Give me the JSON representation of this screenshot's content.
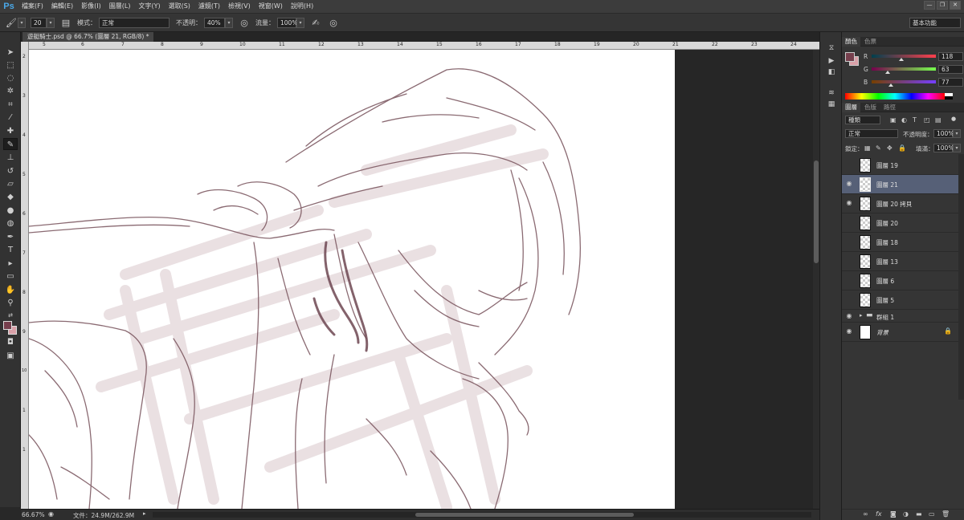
{
  "app": {
    "logo": "Ps",
    "menu": [
      "檔案(F)",
      "編輯(E)",
      "影像(I)",
      "圖層(L)",
      "文字(Y)",
      "選取(S)",
      "濾鏡(T)",
      "檢視(V)",
      "視窗(W)",
      "說明(H)"
    ],
    "window_buttons": [
      "—",
      "❐",
      "✕"
    ]
  },
  "options": {
    "brush_size": "20",
    "mode_label": "模式：",
    "mode_value": "正常",
    "opacity_label": "不透明：",
    "opacity_value": "40%",
    "flow_label": "流量：",
    "flow_value": "100%",
    "workspace": "基本功能"
  },
  "document": {
    "tab_title": "遊艇騎士.psd @ 66.7% (圖層 21, RGB/8) *",
    "ruler_h": [
      "5",
      "6",
      "7",
      "8",
      "9",
      "10",
      "11",
      "12",
      "13",
      "14",
      "15",
      "16",
      "17",
      "18",
      "19",
      "20",
      "21",
      "22",
      "23",
      "24"
    ],
    "ruler_v": [
      "2",
      "3",
      "4",
      "5",
      "6",
      "7",
      "8",
      "9",
      "10",
      "1",
      "1"
    ]
  },
  "status": {
    "zoom": "66.67%",
    "doc_info": "文件：24.9M/262.9M"
  },
  "panels": {
    "color_tabs": [
      "顏色",
      "色票"
    ],
    "color": {
      "fg": "#763f4d",
      "bg": "#d9a0a8",
      "r_label": "R",
      "g_label": "G",
      "b_label": "B",
      "r": "118",
      "g": "63",
      "b": "77",
      "r_fraction": 0.46,
      "g_fraction": 0.25,
      "b_fraction": 0.3
    },
    "layer_tabs": [
      "圖層",
      "色版",
      "路徑"
    ],
    "layers": {
      "filter_label": "種類",
      "blend_mode": "正常",
      "opacity_label": "不透明度：",
      "opacity_value": "100%",
      "lock_label": "鎖定：",
      "fill_label": "填滿：",
      "fill_value": "100%",
      "items": [
        {
          "name": "圖層 19",
          "visible": false,
          "selected": false
        },
        {
          "name": "圖層 21",
          "visible": true,
          "selected": true
        },
        {
          "name": "圖層 20 拷貝",
          "visible": true,
          "selected": false
        },
        {
          "name": "圖層 20",
          "visible": false,
          "selected": false
        },
        {
          "name": "圖層 18",
          "visible": false,
          "selected": false
        },
        {
          "name": "圖層 13",
          "visible": false,
          "selected": false
        },
        {
          "name": "圖層 6",
          "visible": false,
          "selected": false
        },
        {
          "name": "圖層 5",
          "visible": false,
          "selected": false
        },
        {
          "name": "群組 1",
          "visible": true,
          "selected": false,
          "group": true
        },
        {
          "name": "背景",
          "visible": true,
          "selected": false,
          "locked": true
        }
      ]
    }
  }
}
